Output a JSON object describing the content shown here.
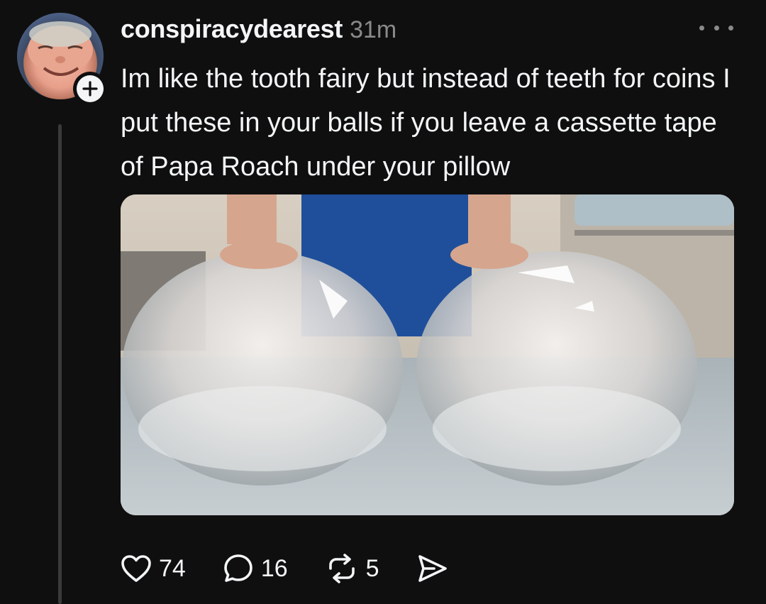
{
  "post": {
    "username": "conspiracydearest",
    "timestamp": "31m",
    "text": "Im like the tooth fairy but instead of teeth for coins I put these in your balls if you leave a cassette tape of Papa Roach under your pillow"
  },
  "icons": {
    "avatar": "profile-photo",
    "follow": "plus-icon",
    "more": "more-horizontal-icon",
    "like": "heart-icon",
    "reply": "comment-icon",
    "repost": "repost-icon",
    "share": "send-icon"
  },
  "actions": {
    "likes": "74",
    "replies": "16",
    "reposts": "5"
  },
  "colors": {
    "background": "#0f0f0f",
    "text": "#f3f5f7",
    "muted": "#8a8a8a"
  }
}
